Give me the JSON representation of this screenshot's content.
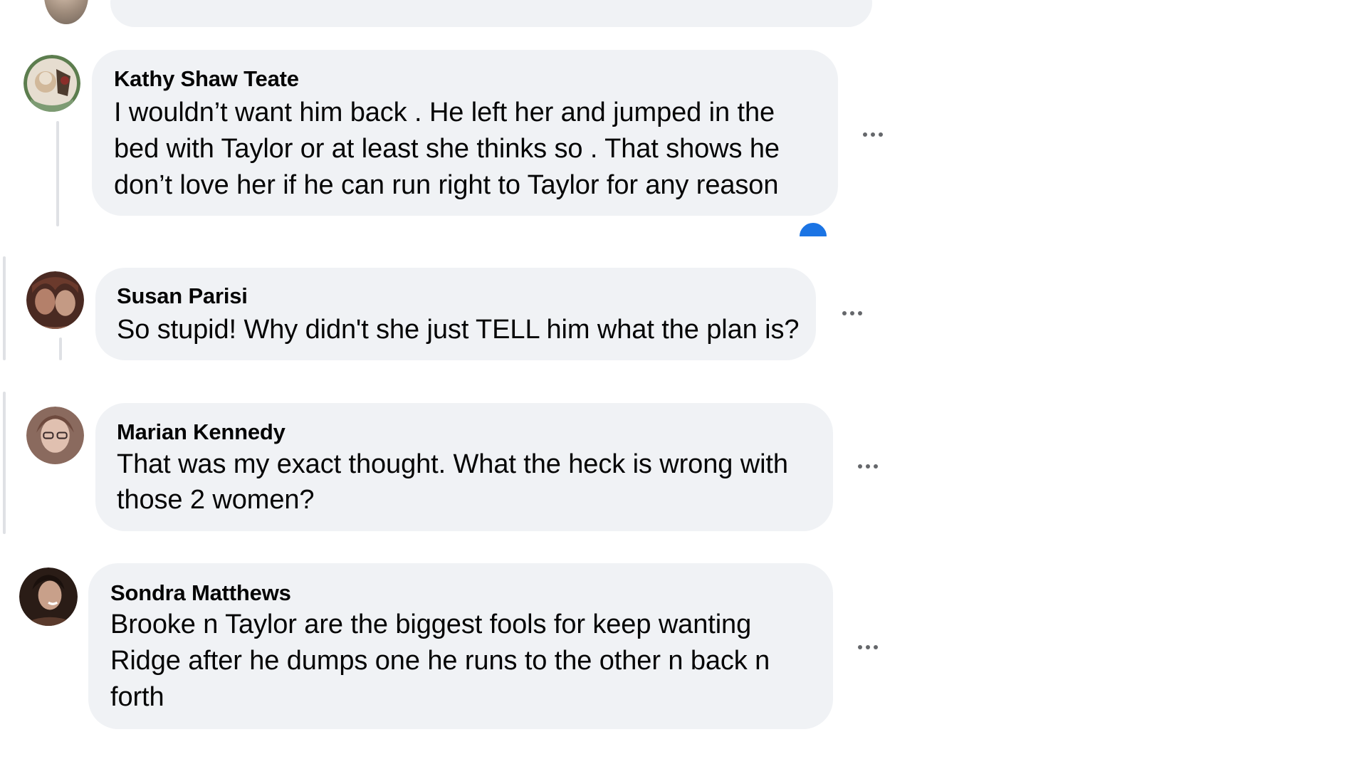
{
  "comments": [
    {
      "author": "Kathy Shaw Teate",
      "lines": [
        "I wouldn’t want him back . He left her and jumped in the",
        "bed with Taylor or at least she thinks so . That shows he",
        "don’t love her if he can run right to Taylor for any reason"
      ],
      "avatar_colors": [
        "#c9b99a",
        "#7a6a4f",
        "#3f6b45"
      ],
      "more_icon": "more-horizontal-icon"
    },
    {
      "author": "Susan Parisi",
      "lines": [
        "So stupid! Why didn't she just TELL him what the plan is?"
      ],
      "avatar_colors": [
        "#8a5a48",
        "#4a2a22",
        "#c49a84"
      ],
      "more_icon": "more-horizontal-icon"
    },
    {
      "author": "Marian Kennedy",
      "lines": [
        "That was my exact thought. What the heck is wrong with",
        "those 2 women?"
      ],
      "avatar_colors": [
        "#b98e7a",
        "#6e4a3e",
        "#e0c0b0"
      ],
      "more_icon": "more-horizontal-icon"
    },
    {
      "author": "Sondra Matthews",
      "lines": [
        "Brooke n Taylor are the biggest fools for keep wanting",
        "Ridge after he dumps one he runs to the other n back n",
        "forth"
      ],
      "avatar_colors": [
        "#2a1c16",
        "#c8a08a",
        "#5a3a2c"
      ],
      "more_icon": "more-horizontal-icon"
    }
  ],
  "colors": {
    "bubble": "#f0f2f5",
    "text": "#050505",
    "icon": "#65676b",
    "thread_line": "#dfe1e5",
    "reaction": "#1b74e4"
  }
}
